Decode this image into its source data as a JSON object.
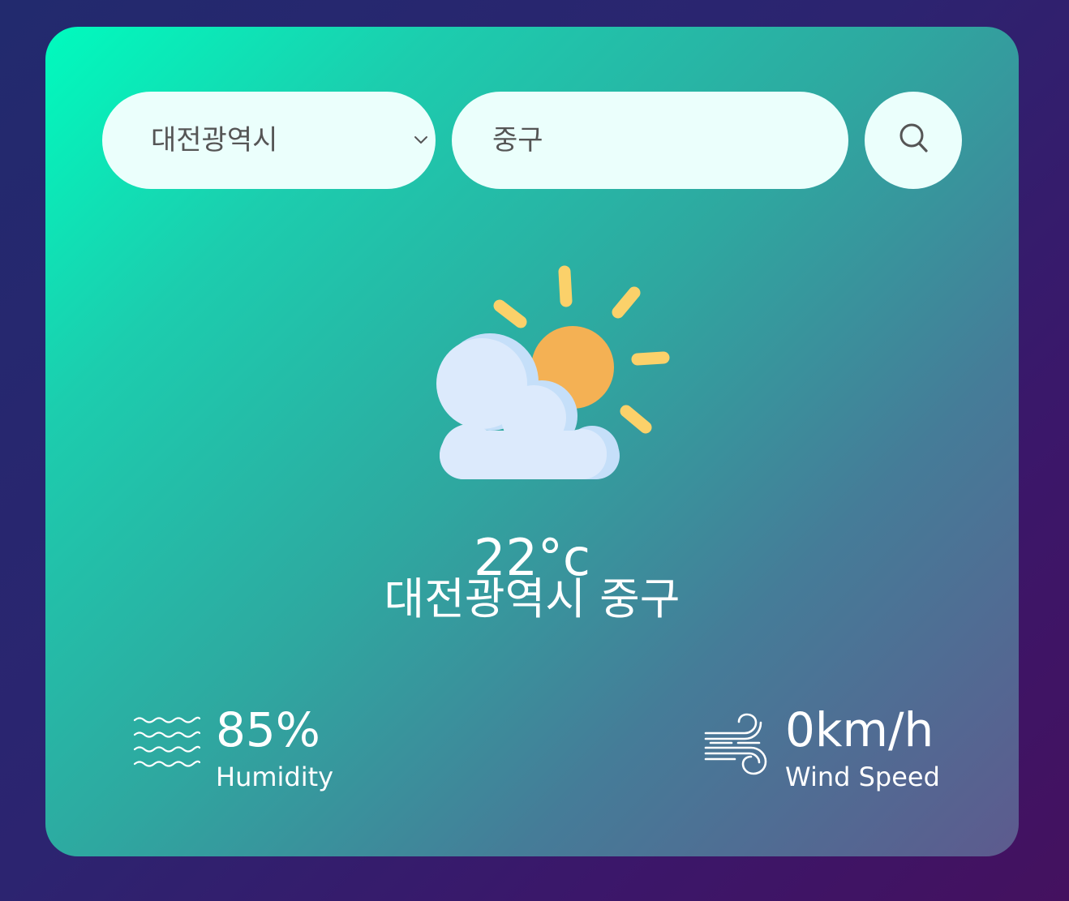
{
  "search": {
    "province_selected": "대전광역시",
    "district_value": "중구",
    "search_icon": "search-icon"
  },
  "weather": {
    "icon": "partly-cloudy-icon",
    "temperature": "22°c",
    "location": "대전광역시 중구"
  },
  "stats": {
    "humidity_value": "85%",
    "humidity_label": "Humidity",
    "humidity_icon": "waves-icon",
    "wind_value": "0km/h",
    "wind_label": "Wind Speed",
    "wind_icon": "wind-icon"
  },
  "colors": {
    "card_gradient_start": "#00fbbe",
    "card_gradient_end": "#5d5a8e",
    "background": "#2c2470",
    "input_background": "#ebfffc",
    "sun": "#f4b154",
    "sun_rays": "#fbd16a",
    "cloud": "#dceafc"
  }
}
